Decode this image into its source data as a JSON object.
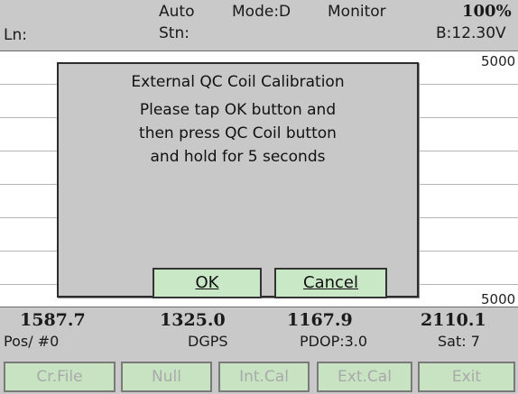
{
  "status": {
    "ln_label": "Ln:",
    "auto": "Auto",
    "mode": "Mode:D",
    "monitor": "Monitor",
    "percent": "100%",
    "stn_label": "Stn:",
    "battery": "B:12.30V"
  },
  "plot": {
    "top_label": "5000",
    "bottom_label": "5000"
  },
  "dialog": {
    "title": "External QC Coil Calibration",
    "line1": "Please tap OK button and",
    "line2": "then press QC Coil button",
    "line3": "and hold for 5 seconds",
    "ok_label": "OK",
    "cancel_label": "Cancel"
  },
  "readouts": {
    "values": [
      "1587.7",
      "1325.0",
      "1167.9",
      "2110.1"
    ],
    "pos": "Pos/ #0",
    "gps": "DGPS",
    "pdop": "PDOP:3.0",
    "sat": "Sat: 7"
  },
  "buttons": {
    "cr_file": "Cr.File",
    "null": "Null",
    "int_cal": "Int.Cal",
    "ext_cal": "Ext.Cal",
    "exit": "Exit"
  }
}
